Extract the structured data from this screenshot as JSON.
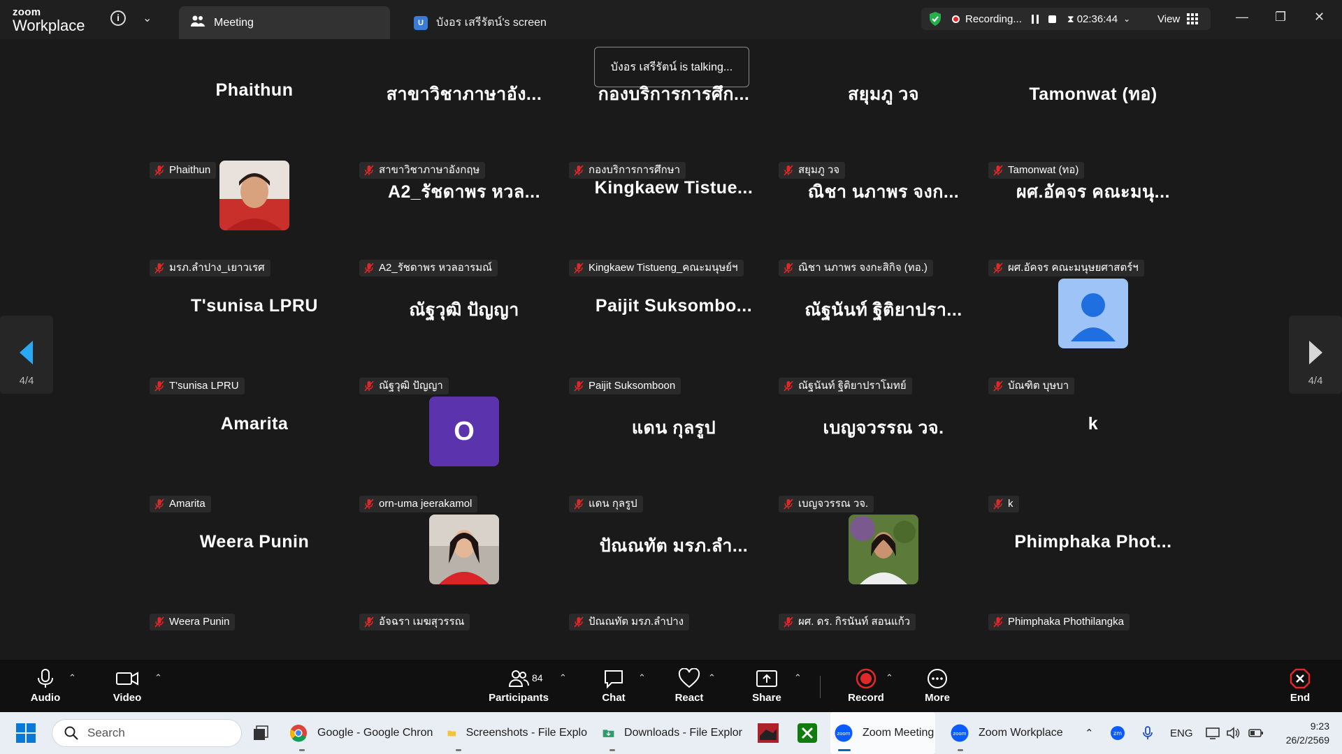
{
  "titlebar": {
    "brand_top": "zoom",
    "brand_bottom": "Workplace",
    "tabs": [
      {
        "label": "Meeting"
      },
      {
        "label": "บังอร  เสรีรัตน์'s screen",
        "badge": "U"
      }
    ],
    "recording_label": "Recording...",
    "timer": "02:36:44",
    "view_label": "View"
  },
  "toast": "บังอร  เสรีรัตน์ is talking...",
  "participants": [
    {
      "big": "Phaithun",
      "label": "Phaithun"
    },
    {
      "big": "สาขาวิชาภาษาอัง...",
      "label": "สาขาวิชาภาษาอังกฤษ"
    },
    {
      "big": "กองบริการการศึก...",
      "label": "กองบริการการศึกษา"
    },
    {
      "big": "สยุมภู  วจ",
      "label": "สยุมภู  วจ"
    },
    {
      "big": "Tamonwat (ทอ)",
      "label": "Tamonwat (ทอ)"
    },
    {
      "big": "",
      "label": "มรภ.ลำปาง_เยาวเรศ",
      "avatar": "photo1"
    },
    {
      "big": "A2_รัชดาพร หวล...",
      "label": "A2_รัชดาพร หวลอารมณ์"
    },
    {
      "big": "Kingkaew  Tistue...",
      "label": "Kingkaew Tistueng_คณะมนุษย์ฯ"
    },
    {
      "big": "ณิชา นภาพร จงก...",
      "label": "ณิชา นภาพร จงกะสิกิจ (ทอ.)"
    },
    {
      "big": "ผศ.อัคจร คณะมนุ...",
      "label": "ผศ.อัคจร คณะมนุษยศาสตร์ฯ"
    },
    {
      "big": "T'sunisa LPRU",
      "label": "T'sunisa LPRU"
    },
    {
      "big": "ณัฐวุฒิ ปัญญา",
      "label": "ณัฐวุฒิ ปัญญา"
    },
    {
      "big": "Paijit  Suksombo...",
      "label": "Paijit Suksomboon"
    },
    {
      "big": "ณัฐนันท์ ฐิติยาปรา...",
      "label": "ณัฐนันท์ ฐิติยาปราโมทย์"
    },
    {
      "big": "",
      "label": "บัณฑิต บุษบา",
      "avatar": "default"
    },
    {
      "big": "Amarita",
      "label": "Amarita"
    },
    {
      "big": "",
      "label": "orn-uma jeerakamol",
      "avatar": "letter",
      "letter": "O"
    },
    {
      "big": "แดน  กุลรูป",
      "label": "แดน  กุลรูป"
    },
    {
      "big": "เบญจวรรณ วจ.",
      "label": "เบญจวรรณ วจ."
    },
    {
      "big": "k",
      "label": "k"
    },
    {
      "big": "Weera Punin",
      "label": "Weera Punin"
    },
    {
      "big": "",
      "label": "อัจฉรา เมฆสุวรรณ",
      "avatar": "photo2"
    },
    {
      "big": "ปัณณทัต มรภ.ลำ...",
      "label": "ปัณณทัต มรภ.ลำปาง"
    },
    {
      "big": "",
      "label": "ผศ. ดร. กิรนันท์ สอนแก้ว",
      "avatar": "photo3"
    },
    {
      "big": "Phimphaka  Phot...",
      "label": "Phimphaka Phothilangka"
    }
  ],
  "pagination": {
    "left": "4/4",
    "right": "4/4"
  },
  "toolbar": {
    "audio": "Audio",
    "video": "Video",
    "participants": "Participants",
    "participants_count": "84",
    "chat": "Chat",
    "react": "React",
    "share": "Share",
    "record": "Record",
    "more": "More",
    "end": "End"
  },
  "taskbar": {
    "search_placeholder": "Search",
    "apps": [
      {
        "label": "Google - Google Chron"
      },
      {
        "label": "Screenshots - File Explo"
      },
      {
        "label": "Downloads - File Explor"
      },
      {
        "label": "Zoom Meeting"
      },
      {
        "label": "Zoom Workplace"
      }
    ],
    "lang": "ENG",
    "time": "9:23",
    "date": "26/2/2569"
  },
  "colors": {
    "accent_blue": "#0b5cff",
    "recording_red": "#e02828",
    "mute_red": "#e02828",
    "shield_green": "#23b04b"
  }
}
